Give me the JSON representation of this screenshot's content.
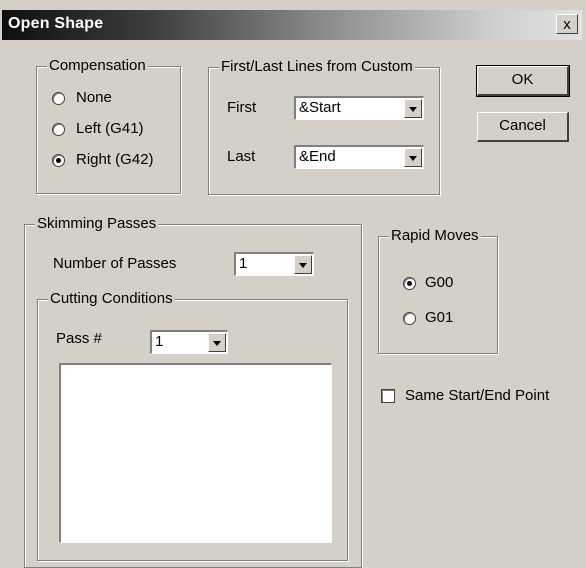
{
  "window": {
    "title": "Open Shape",
    "close_glyph": "x"
  },
  "compensation": {
    "legend": "Compensation",
    "options": [
      "None",
      "Left (G41)",
      "Right (G42)"
    ],
    "selected": "Right (G42)"
  },
  "first_last": {
    "legend": "First/Last Lines from Custom",
    "first_label": "First",
    "first_value": "&Start",
    "last_label": "Last",
    "last_value": "&End"
  },
  "buttons": {
    "ok": "OK",
    "cancel": "Cancel"
  },
  "skimming": {
    "legend": "Skimming Passes",
    "number_label": "Number of Passes",
    "number_value": "1",
    "cutting": {
      "legend": "Cutting Conditions",
      "pass_label": "Pass #",
      "pass_value": "1"
    }
  },
  "rapid": {
    "legend": "Rapid Moves",
    "options": [
      "G00",
      "G01"
    ],
    "selected": "G00"
  },
  "same_point": {
    "label": "Same Start/End Point",
    "checked": false
  }
}
